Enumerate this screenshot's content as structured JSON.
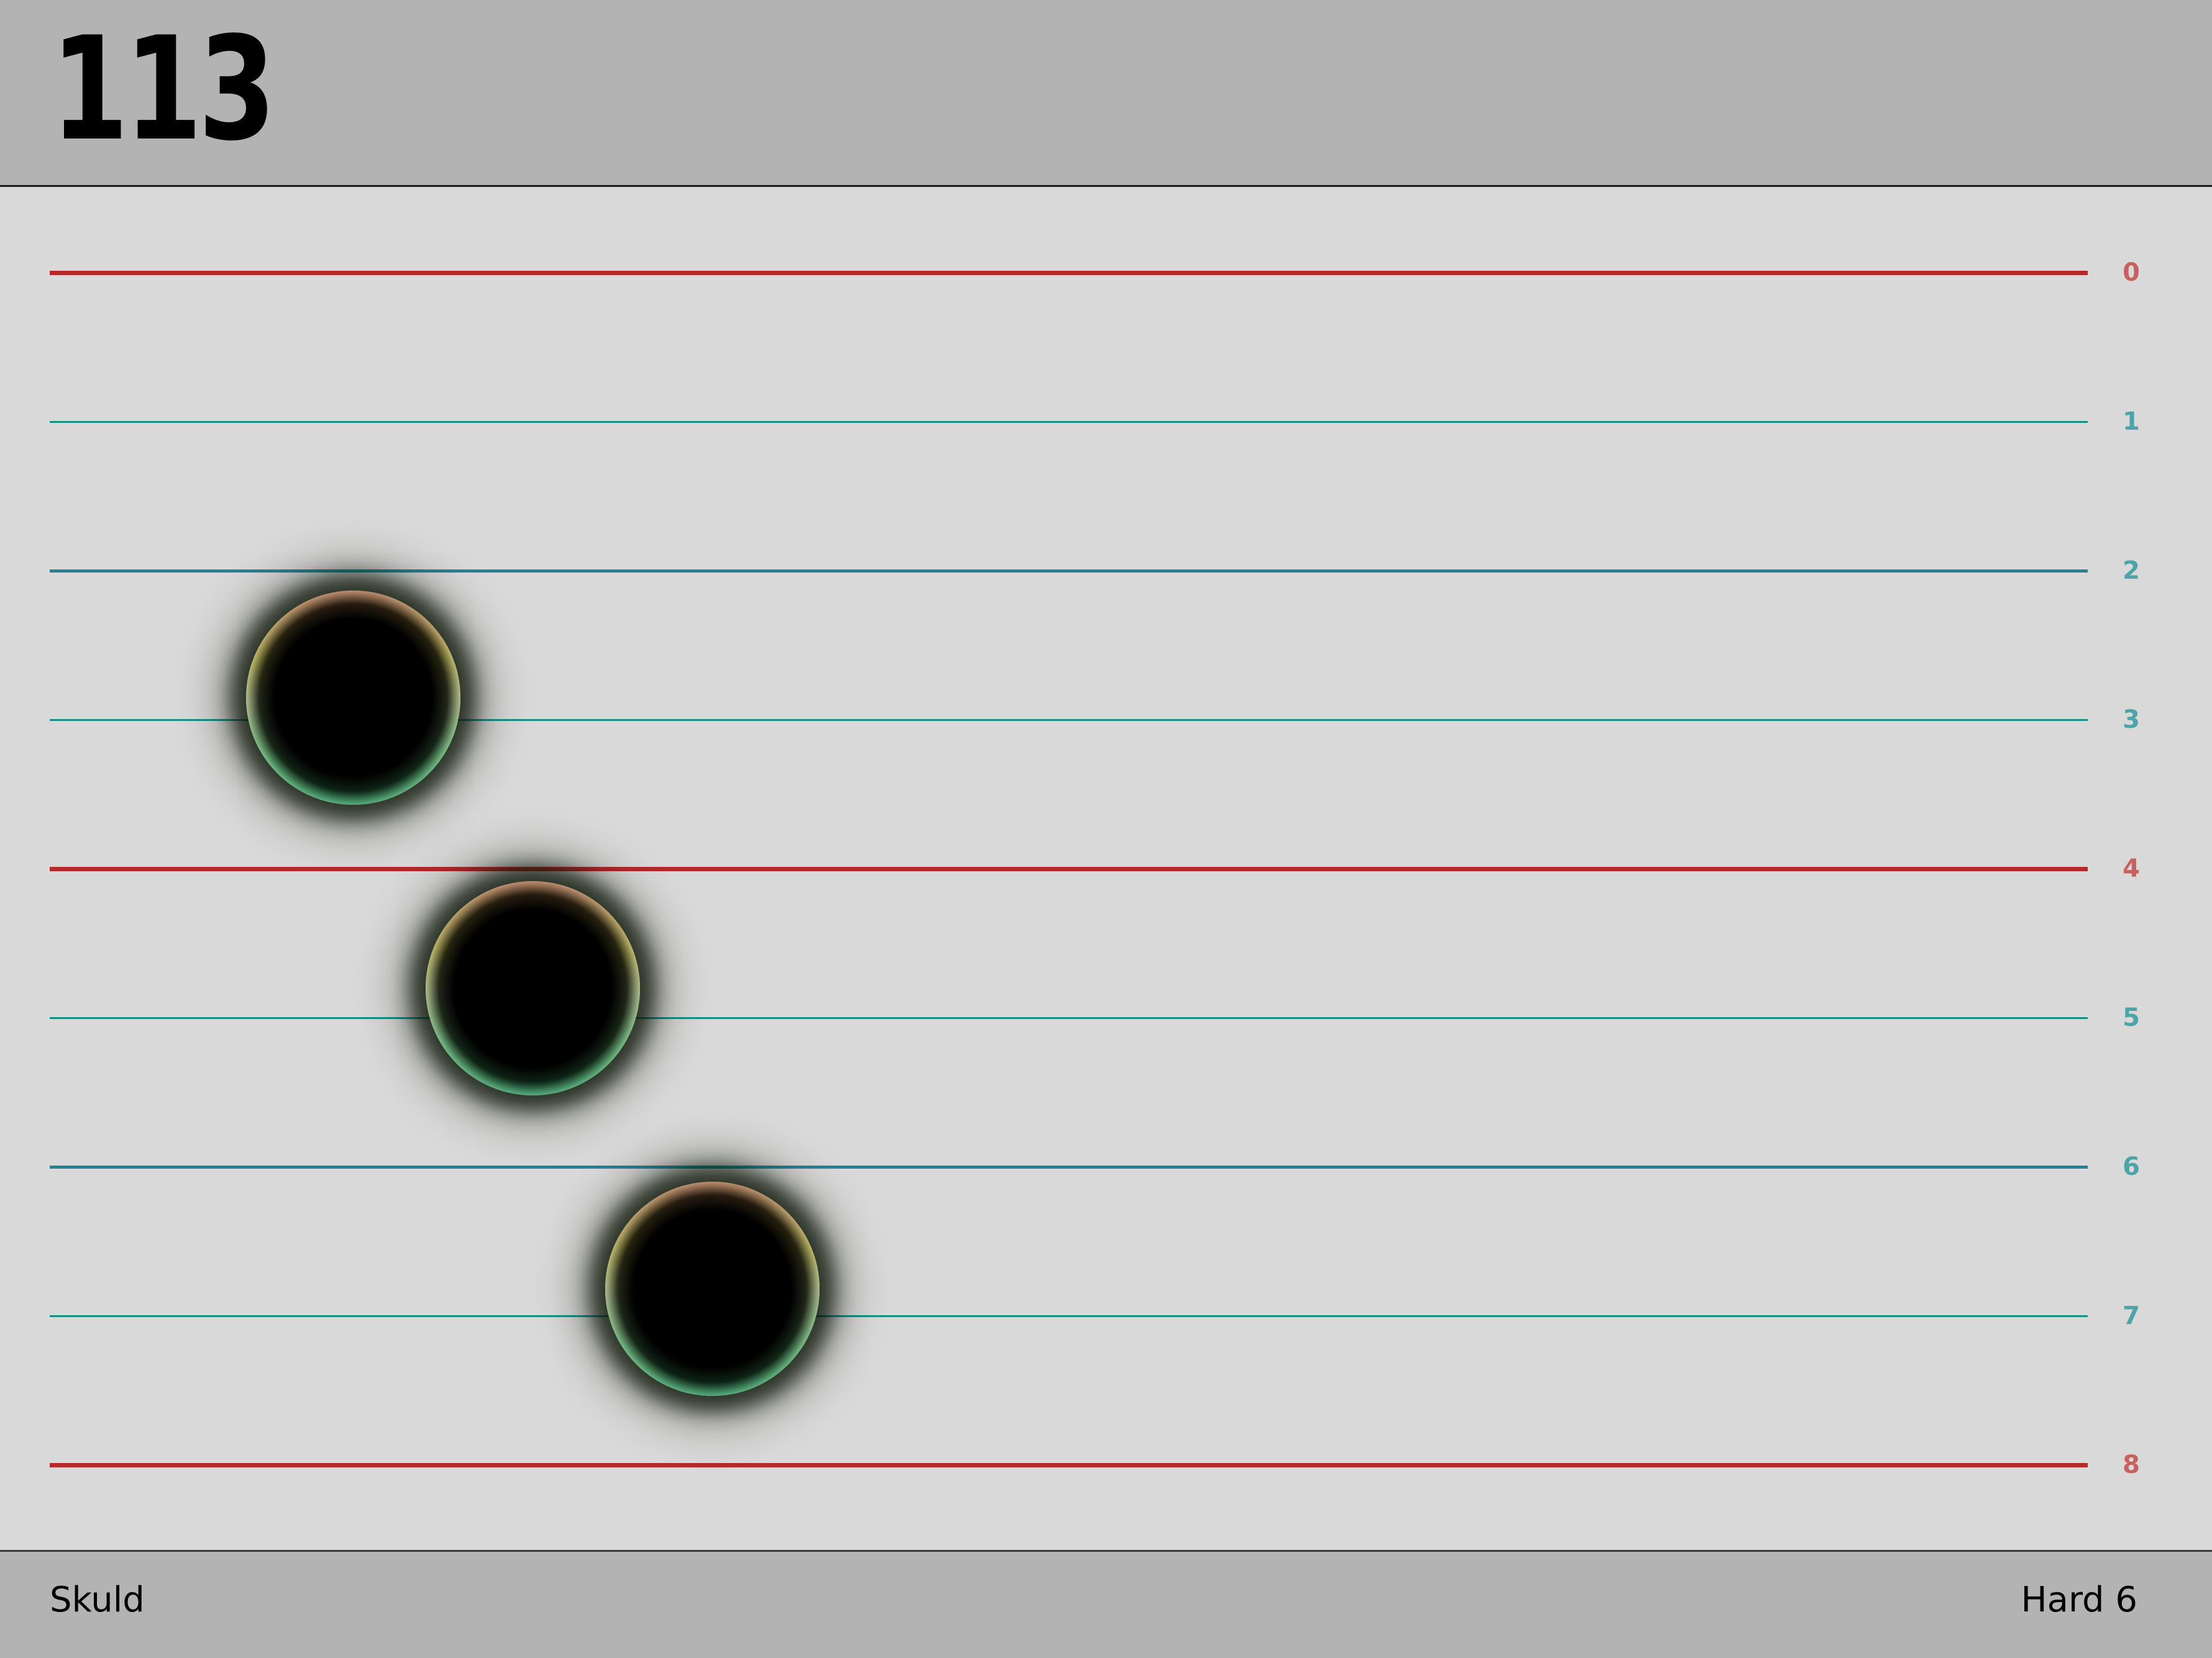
{
  "header": {
    "score": "113"
  },
  "lanes": {
    "labels": [
      "0",
      "1",
      "2",
      "3",
      "4",
      "5",
      "6",
      "7",
      "8"
    ],
    "accent_color": "#b22a2a",
    "accent_label_color": "#c96060",
    "normal_color": "#1b8a8f",
    "normal_label_color": "#4aa4a8",
    "accent_lanes": [
      0,
      4,
      8
    ]
  },
  "balls": [
    {
      "lane_position": 2.85
    },
    {
      "lane_position": 4.8
    },
    {
      "lane_position": 6.82
    }
  ],
  "footer": {
    "left_text": "Skuld",
    "right_text": "Hard 6"
  }
}
